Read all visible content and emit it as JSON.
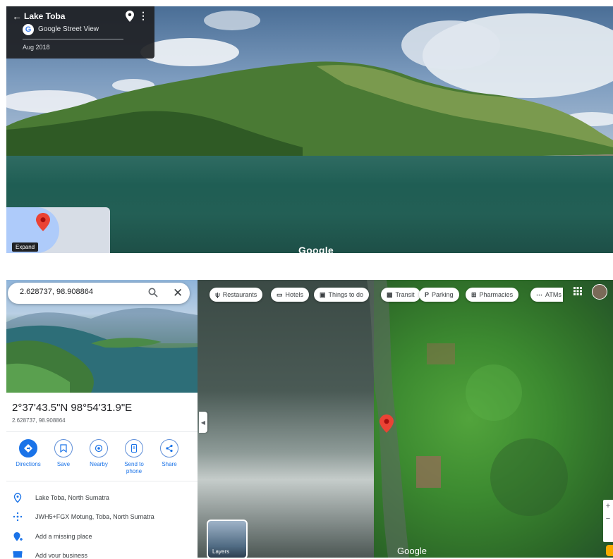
{
  "street_view": {
    "place_name": "Lake Toba",
    "source_label": "Google Street View",
    "capture_date": "Aug 2018",
    "expand_label": "Expand",
    "watermark": "Google"
  },
  "maps": {
    "search": {
      "value": "2.628737, 98.908864"
    },
    "place": {
      "coordinates_dms": "2°37'43.5\"N 98°54'31.9\"E",
      "coordinates_decimal": "2.628737, 98.908864"
    },
    "actions": [
      {
        "label": "Directions",
        "icon": "directions-icon"
      },
      {
        "label": "Save",
        "icon": "bookmark-icon"
      },
      {
        "label": "Nearby",
        "icon": "nearby-icon"
      },
      {
        "label": "Send to phone",
        "icon": "send-to-phone-icon"
      },
      {
        "label": "Share",
        "icon": "share-icon"
      }
    ],
    "info_rows": [
      {
        "text": "Lake Toba, North Sumatra",
        "icon": "location-pin-icon"
      },
      {
        "text": "JWH5+FGX Motung, Toba, North Sumatra",
        "icon": "plus-code-icon"
      },
      {
        "text": "Add a missing place",
        "icon": "add-place-icon"
      },
      {
        "text": "Add your business",
        "icon": "business-icon"
      }
    ],
    "categories": [
      {
        "label": "Restaurants",
        "icon": "restaurant-icon"
      },
      {
        "label": "Hotels",
        "icon": "hotel-icon"
      },
      {
        "label": "Things to do",
        "icon": "camera-icon"
      },
      {
        "label": "Transit",
        "icon": "transit-icon"
      },
      {
        "label": "Parking",
        "icon": "parking-icon"
      },
      {
        "label": "Pharmacies",
        "icon": "pharmacy-icon"
      },
      {
        "label": "ATMs",
        "icon": "atm-icon"
      }
    ],
    "layers_label": "Layers",
    "watermark": "Google"
  },
  "colors": {
    "accent": "#1a73e8",
    "pin": "#ea4335"
  }
}
